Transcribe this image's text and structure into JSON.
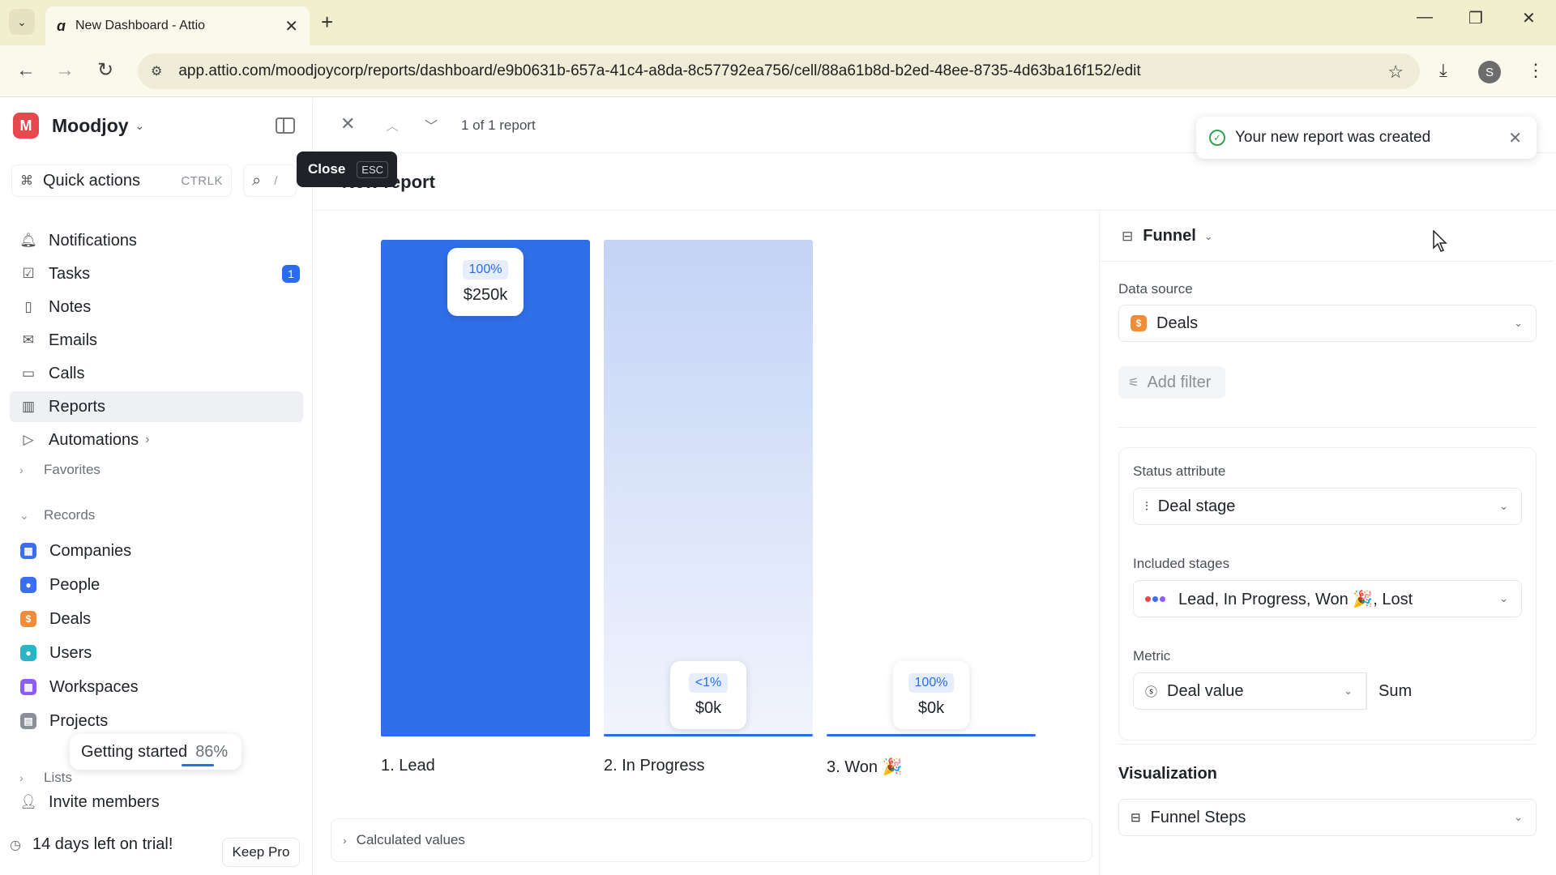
{
  "browser": {
    "tab_title": "New Dashboard - Attio",
    "url": "app.attio.com/moodjoycorp/reports/dashboard/e9b0631b-657a-41c4-a8da-8c57792ea756/cell/88a61b8d-b2ed-48ee-8735-4d63ba16f152/edit",
    "profile_initial": "S"
  },
  "sidebar": {
    "workspace_initial": "M",
    "workspace_name": "Moodjoy",
    "quick_actions": {
      "label": "Quick actions",
      "shortcut": "CTRLK"
    },
    "search_shortcut": "/",
    "nav": [
      {
        "label": "Notifications",
        "icon": "bell-icon"
      },
      {
        "label": "Tasks",
        "icon": "check-square-icon",
        "badge": "1"
      },
      {
        "label": "Notes",
        "icon": "note-icon"
      },
      {
        "label": "Emails",
        "icon": "mail-icon"
      },
      {
        "label": "Calls",
        "icon": "video-icon"
      },
      {
        "label": "Reports",
        "icon": "chart-icon",
        "active": true
      },
      {
        "label": "Automations",
        "icon": "play-icon"
      }
    ],
    "favorites_label": "Favorites",
    "records_label": "Records",
    "records": [
      {
        "label": "Companies",
        "icon": "companies-icon",
        "color": "#3b6ff0"
      },
      {
        "label": "People",
        "icon": "people-icon",
        "color": "#3b6ff0"
      },
      {
        "label": "Deals",
        "icon": "deals-icon",
        "color": "#f08c3a"
      },
      {
        "label": "Users",
        "icon": "users-icon",
        "color": "#2bb3c9"
      },
      {
        "label": "Workspaces",
        "icon": "workspaces-icon",
        "color": "#8b5cf6"
      },
      {
        "label": "Projects",
        "icon": "projects-icon",
        "color": "#8a8f98"
      }
    ],
    "getting_started": {
      "label": "Getting started",
      "percent": "86%"
    },
    "lists_label": "Lists",
    "invite_label": "Invite members",
    "trial_label": "14 days left on trial!",
    "keep_pro_label": "Keep Pro"
  },
  "main": {
    "counter": "1 of 1 report",
    "tooltip": {
      "label": "Close",
      "shortcut": "ESC"
    },
    "report_title": "New report",
    "toast": "Your new report was created",
    "calculated_values_label": "Calculated values"
  },
  "chart_data": {
    "type": "bar",
    "categories": [
      "1. Lead",
      "2. In Progress",
      "3. Won 🎉"
    ],
    "values": [
      250,
      0,
      0
    ],
    "value_labels": [
      "$250k",
      "$0k",
      "$0k"
    ],
    "percent_labels": [
      "100%",
      "<1%",
      "100%"
    ],
    "ylim": [
      0,
      250
    ],
    "colors": [
      "#2f6fe8",
      "#c3d3f6",
      "#ffffff"
    ]
  },
  "panel": {
    "chart_type": "Funnel",
    "data_source_label": "Data source",
    "data_source_value": "Deals",
    "add_filter_label": "Add filter",
    "status_attribute_label": "Status attribute",
    "status_attribute_value": "Deal stage",
    "included_stages_label": "Included stages",
    "included_stages_value": "Lead, In Progress, Won 🎉, Lost",
    "stage_dot_colors": [
      "#e5484d",
      "#3b6ff0",
      "#8b5cf6"
    ],
    "metric_label": "Metric",
    "metric_value": "Deal value",
    "metric_agg": "Sum",
    "visualization_label": "Visualization",
    "visualization_value": "Funnel Steps"
  }
}
